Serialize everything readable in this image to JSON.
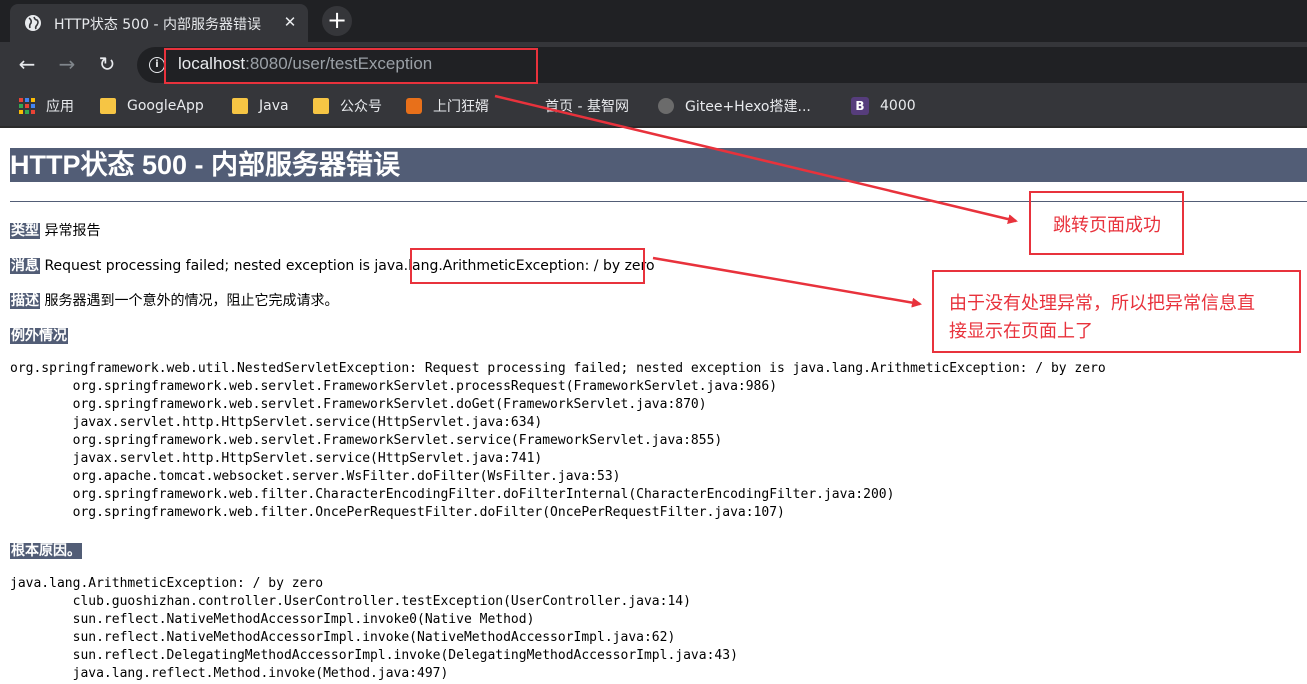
{
  "browser": {
    "tab_title": "HTTP状态 500 - 内部服务器错误",
    "url_host": "localhost",
    "url_rest": ":8080/user/testException",
    "bookmarks": [
      {
        "label": "应用",
        "icon": "apps-grid-icon"
      },
      {
        "label": "GoogleApp",
        "icon": "folder-icon"
      },
      {
        "label": "Java",
        "icon": "folder-icon"
      },
      {
        "label": "公众号",
        "icon": "folder-icon"
      },
      {
        "label": "上门狂婿",
        "icon": "site-favicon-icon"
      },
      {
        "label": "首页 - 基智网",
        "icon": "site-favicon-icon"
      },
      {
        "label": "Gitee+Hexo搭建...",
        "icon": "site-favicon-icon"
      },
      {
        "label": "4000",
        "icon": "bootstrap-icon"
      }
    ]
  },
  "page": {
    "title": "HTTP状态 500 - 内部服务器错误",
    "type_label": "类型",
    "type_value": "异常报告",
    "message_label": "消息",
    "message_value": "Request processing failed; nested exception is java.lang.ArithmeticException: / by zero",
    "desc_label": "描述",
    "desc_value": "服务器遇到一个意外的情况，阻止它完成请求。",
    "exception_label": "例外情况",
    "exception_trace": "org.springframework.web.util.NestedServletException: Request processing failed; nested exception is java.lang.ArithmeticException: / by zero\n\torg.springframework.web.servlet.FrameworkServlet.processRequest(FrameworkServlet.java:986)\n\torg.springframework.web.servlet.FrameworkServlet.doGet(FrameworkServlet.java:870)\n\tjavax.servlet.http.HttpServlet.service(HttpServlet.java:634)\n\torg.springframework.web.servlet.FrameworkServlet.service(FrameworkServlet.java:855)\n\tjavax.servlet.http.HttpServlet.service(HttpServlet.java:741)\n\torg.apache.tomcat.websocket.server.WsFilter.doFilter(WsFilter.java:53)\n\torg.springframework.web.filter.CharacterEncodingFilter.doFilterInternal(CharacterEncodingFilter.java:200)\n\torg.springframework.web.filter.OncePerRequestFilter.doFilter(OncePerRequestFilter.java:107)",
    "root_cause_label": "根本原因。",
    "root_cause_trace": "java.lang.ArithmeticException: / by zero\n\tclub.guoshizhan.controller.UserController.testException(UserController.java:14)\n\tsun.reflect.NativeMethodAccessorImpl.invoke0(Native Method)\n\tsun.reflect.NativeMethodAccessorImpl.invoke(NativeMethodAccessorImpl.java:62)\n\tsun.reflect.DelegatingMethodAccessorImpl.invoke(DelegatingMethodAccessorImpl.java:43)\n\tjava.lang.reflect.Method.invoke(Method.java:497)"
  },
  "annotations": {
    "note1": "跳转页面成功",
    "note2_line1": "由于没有处理异常，所以把异常信息直",
    "note2_line2": "接显示在页面上了",
    "color": "#e8323c"
  }
}
